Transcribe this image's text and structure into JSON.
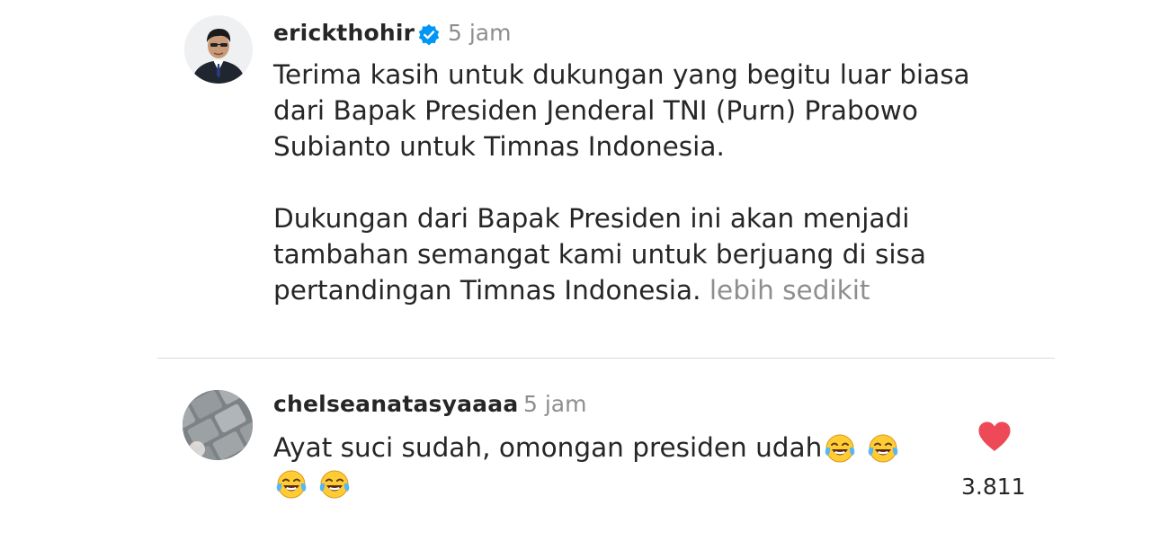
{
  "post": {
    "username": "erickthohir",
    "verified_icon": "verified-badge-icon",
    "time": "5 jam",
    "caption_paragraph_1": "Terima kasih untuk dukungan yang begitu luar biasa dari Bapak Presiden Jenderal TNI (Purn) Prabowo Subianto untuk Timnas Indonesia.",
    "caption_paragraph_2": "Dukungan dari Bapak Presiden ini akan menjadi tambahan semangat kami untuk berjuang di sisa pertandingan Timnas Indonesia.",
    "more_label": "lebih sedikit"
  },
  "reply": {
    "username": "chelseanatasyaaaa",
    "time": "5 jam",
    "text": "Ayat suci sudah, omongan presiden udah",
    "emojis": [
      "face-with-tears-of-joy-icon",
      "face-with-tears-of-joy-icon",
      "face-with-tears-of-joy-icon",
      "face-with-tears-of-joy-icon"
    ],
    "like_icon": "heart-icon",
    "like_count": "3.811"
  },
  "colors": {
    "text": "#262626",
    "secondary": "#8e8e8e",
    "verified_blue": "#0095f6",
    "like_red": "#ed4956",
    "divider": "#dbdbdb"
  }
}
